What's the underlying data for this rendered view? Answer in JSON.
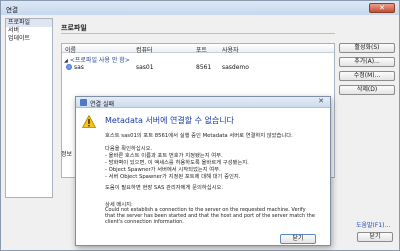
{
  "window": {
    "title": "연결",
    "close_glyph": "✕"
  },
  "nav": {
    "items": [
      {
        "label": "프로파일"
      },
      {
        "label": "서버"
      },
      {
        "label": "업데이트"
      }
    ]
  },
  "content": {
    "title": "프로파일",
    "columns": [
      "이름",
      "컴퓨터",
      "포트",
      "사용자"
    ],
    "group_label": "<프로파일 사용 안 함>",
    "profile": {
      "name": "sas",
      "computer": "sas01",
      "port": "8561",
      "user": "sasdemo"
    },
    "status_label": "정보"
  },
  "buttons": {
    "activate": "활성화(S)",
    "add": "추가(A)...",
    "edit": "수정(M)...",
    "delete": "삭제(D)"
  },
  "footer": {
    "help": "도움말(F1)...",
    "close": "닫기"
  },
  "dialog": {
    "title": "연결 실패",
    "close_glyph": "✕",
    "heading": "Metadata 서버에 연결할 수 없습니다",
    "line1": "호스트 sas01의 포트 8561에서 실행 중인 Metadata 서버로 연결하지 않았습니다.",
    "line2": "다음을 확인하십시오.",
    "bullet1": "- 올바른 호스트 이름과 포트 번호가 지정됐는지 여부.",
    "bullet2": "- 방화벽이 있으면, 이 액세스를 허용하도록 올바르게 구성됐는지.",
    "bullet3": "- Object Spawner가 서버에서 시작되었는지 여부.",
    "bullet4": "- 서버 Object Spawner가 지정된 포트에 대해 대기 중인지.",
    "line3": "도움이 필요하면 현장 SAS 관리자에게 문의하십시오.",
    "details_label": "상세 메시지:",
    "detail1": "Could not establish a connection to the server on the requested machine.  Verify",
    "detail2": "that the server has been started and that the host and port of the server match the",
    "detail3": "client's connection information.",
    "ok": "닫기"
  },
  "colors": {
    "accent_blue": "#1a3aa3",
    "warning_yellow": "#f5c518",
    "titlebar": "#cedbee"
  }
}
